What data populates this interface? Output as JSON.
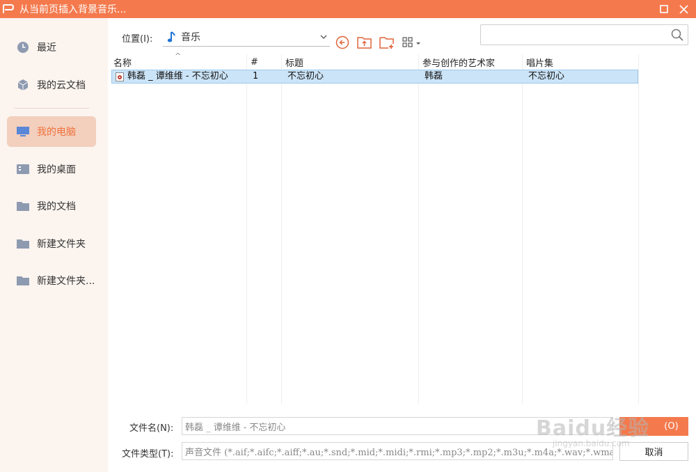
{
  "window": {
    "title": "从当前页插入背景音乐..."
  },
  "sidebar": {
    "items": [
      {
        "label": "最近",
        "icon": "clock-icon"
      },
      {
        "label": "我的云文档",
        "icon": "cloud-cube-icon"
      },
      {
        "label": "我的电脑",
        "icon": "monitor-icon",
        "active": true
      },
      {
        "label": "我的桌面",
        "icon": "desktop-icon"
      },
      {
        "label": "我的文档",
        "icon": "folder-icon"
      },
      {
        "label": "新建文件夹",
        "icon": "folder-icon"
      },
      {
        "label": "新建文件夹...",
        "icon": "folder-icon"
      }
    ]
  },
  "location": {
    "label": "位置(I):",
    "value": "音乐"
  },
  "search": {
    "placeholder": ""
  },
  "file_list": {
    "columns": [
      "名称",
      "#",
      "标题",
      "参与创作的艺术家",
      "唱片集"
    ],
    "rows": [
      {
        "name": "韩磊 _ 谭维维 - 不忘初心",
        "number": "1",
        "title": "不忘初心",
        "artist": "韩磊",
        "album": "不忘初心",
        "selected": true
      }
    ]
  },
  "footer": {
    "filename_label": "文件名(N):",
    "filename_value": "韩磊 _ 谭维维 - 不忘初心",
    "filetype_label": "文件类型(T):",
    "filetype_value": "声音文件 (*.aif;*.aifc;*.aiff;*.au;*.snd;*.mid;*.midi;*.rmi;*.mp3;*.mp2;*.m3u;*.m4a;*.wav;*.wma;*.wax)",
    "open_label": "(O)",
    "cancel_label": "取消"
  },
  "watermark": {
    "text": "Baidu经验",
    "sub": "jingyan.baidu.com"
  },
  "colors": {
    "accent": "#f47a4d",
    "selection": "#cce4f7",
    "sidebar_bg": "#fbf4ef"
  }
}
